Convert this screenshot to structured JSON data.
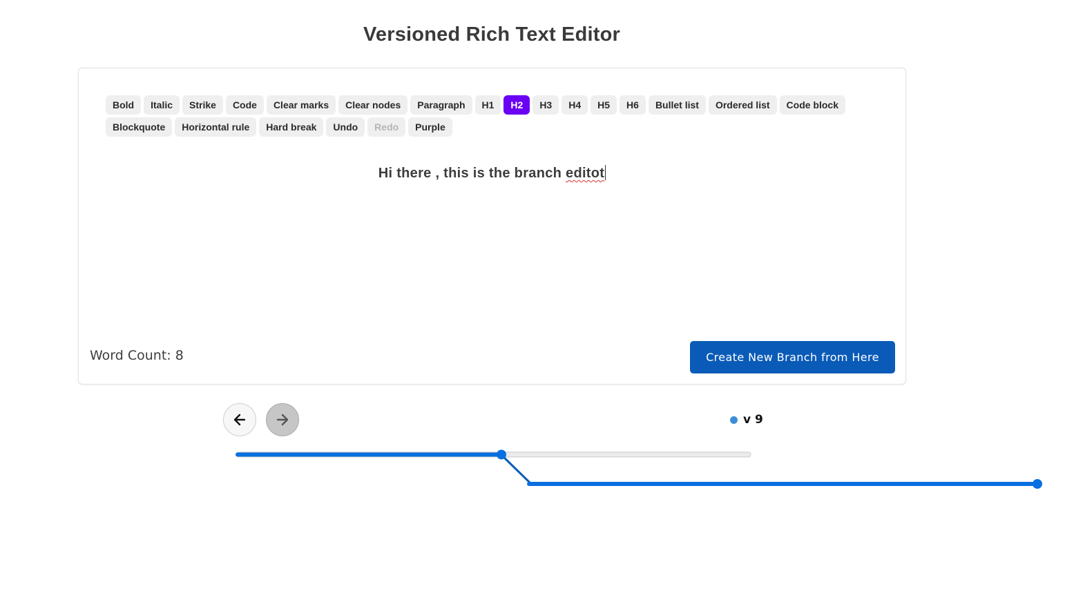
{
  "header": {
    "title": "Versioned Rich Text Editor"
  },
  "toolbar": {
    "buttons": [
      {
        "id": "bold",
        "label": "Bold",
        "state": "normal"
      },
      {
        "id": "italic",
        "label": "Italic",
        "state": "normal"
      },
      {
        "id": "strike",
        "label": "Strike",
        "state": "normal"
      },
      {
        "id": "code",
        "label": "Code",
        "state": "normal"
      },
      {
        "id": "clear-marks",
        "label": "Clear marks",
        "state": "normal"
      },
      {
        "id": "clear-nodes",
        "label": "Clear nodes",
        "state": "normal"
      },
      {
        "id": "paragraph",
        "label": "Paragraph",
        "state": "normal"
      },
      {
        "id": "h1",
        "label": "H1",
        "state": "normal"
      },
      {
        "id": "h2",
        "label": "H2",
        "state": "active"
      },
      {
        "id": "h3",
        "label": "H3",
        "state": "normal"
      },
      {
        "id": "h4",
        "label": "H4",
        "state": "normal"
      },
      {
        "id": "h5",
        "label": "H5",
        "state": "normal"
      },
      {
        "id": "h6",
        "label": "H6",
        "state": "normal"
      },
      {
        "id": "bullet-list",
        "label": "Bullet list",
        "state": "normal"
      },
      {
        "id": "ordered-list",
        "label": "Ordered list",
        "state": "normal"
      },
      {
        "id": "code-block",
        "label": "Code block",
        "state": "normal"
      },
      {
        "id": "blockquote",
        "label": "Blockquote",
        "state": "normal"
      },
      {
        "id": "horizontal-rule",
        "label": "Horizontal rule",
        "state": "normal"
      },
      {
        "id": "hard-break",
        "label": "Hard break",
        "state": "normal"
      },
      {
        "id": "undo",
        "label": "Undo",
        "state": "normal"
      },
      {
        "id": "redo",
        "label": "Redo",
        "state": "disabled"
      },
      {
        "id": "purple",
        "label": "Purple",
        "state": "normal"
      }
    ],
    "active_color": "#6a00f4"
  },
  "editor": {
    "text_main": "Hi there , this is the branch ",
    "text_misspelled": "editot"
  },
  "footer": {
    "word_count_label": "Word Count:",
    "word_count_value": "8",
    "branch_button_label": "Create New Branch from Here",
    "branch_button_color": "#0a5bb8"
  },
  "history": {
    "prev_icon": "arrow-left-icon",
    "next_icon": "arrow-right-icon",
    "current_version": "v 9",
    "line_color": "#0a6fe0"
  }
}
